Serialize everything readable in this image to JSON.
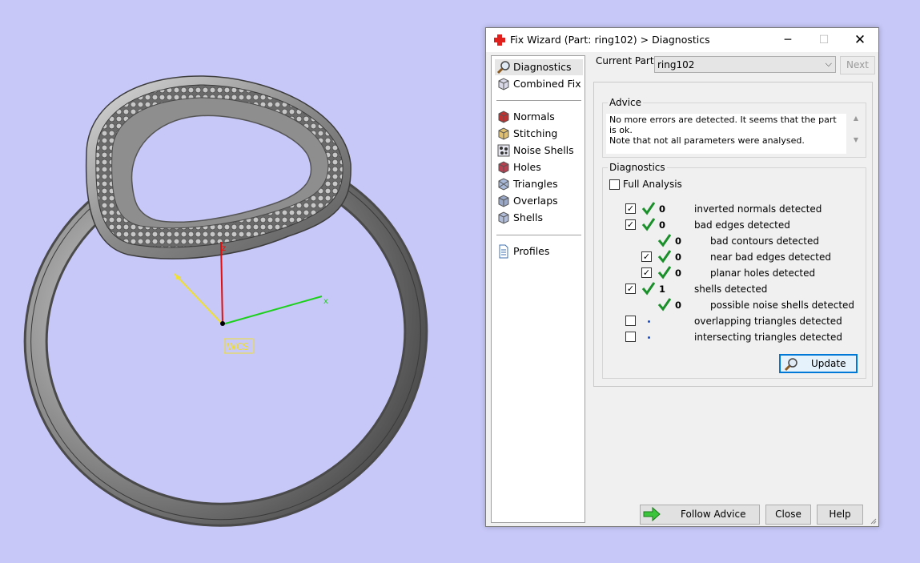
{
  "viewport": {
    "background": "#c8c8f8",
    "axes": {
      "z_label": "z",
      "x_label": "x",
      "y_label": "y",
      "wcs_label": "WCS"
    }
  },
  "dialog": {
    "title": "Fix Wizard (Part: ring102) > Diagnostics",
    "min_glyph": "─",
    "max_glyph": "☐",
    "close_glyph": "✕"
  },
  "nav": {
    "top_items": [
      {
        "label": "Diagnostics",
        "icon": "magnifier-icon",
        "selected": true
      },
      {
        "label": "Combined Fix",
        "icon": "cube-icon"
      }
    ],
    "fix_items": [
      {
        "label": "Normals",
        "icon": "normals-cube-icon"
      },
      {
        "label": "Stitching",
        "icon": "stitching-cube-icon"
      },
      {
        "label": "Noise Shells",
        "icon": "noise-shells-icon"
      },
      {
        "label": "Holes",
        "icon": "holes-cube-icon"
      },
      {
        "label": "Triangles",
        "icon": "triangles-cube-icon"
      },
      {
        "label": "Overlaps",
        "icon": "overlaps-cube-icon"
      },
      {
        "label": "Shells",
        "icon": "shells-cube-icon"
      }
    ],
    "bottom_items": [
      {
        "label": "Profiles",
        "icon": "document-icon"
      }
    ]
  },
  "current_part": {
    "label": "Current Part:",
    "value": "ring102",
    "next_label": "Next"
  },
  "advice": {
    "title": "Advice",
    "line1": "No more errors are detected. It seems that the part is ok.",
    "line2": "Note that not all parameters were analysed."
  },
  "diagnostics": {
    "title": "Diagnostics",
    "full_analysis_label": "Full Analysis",
    "full_analysis_checked": false,
    "rows": [
      {
        "has_checkbox": true,
        "checked": true,
        "status": "ok",
        "count": "0",
        "label": "inverted normals detected",
        "indent": 0
      },
      {
        "has_checkbox": true,
        "checked": true,
        "status": "ok",
        "count": "0",
        "label": "bad edges detected",
        "indent": 0
      },
      {
        "has_checkbox": false,
        "checked": false,
        "status": "ok",
        "count": "0",
        "label": "bad contours detected",
        "indent": 1
      },
      {
        "has_checkbox": true,
        "checked": true,
        "status": "ok",
        "count": "0",
        "label": "near bad edges detected",
        "indent": 1
      },
      {
        "has_checkbox": true,
        "checked": true,
        "status": "ok",
        "count": "0",
        "label": "planar holes detected",
        "indent": 1
      },
      {
        "has_checkbox": true,
        "checked": true,
        "status": "ok",
        "count": "1",
        "label": "shells detected",
        "indent": 0
      },
      {
        "has_checkbox": false,
        "checked": false,
        "status": "ok",
        "count": "0",
        "label": "possible noise shells detected",
        "indent": 1
      },
      {
        "has_checkbox": true,
        "checked": false,
        "status": "none",
        "count": "",
        "label": "overlapping triangles detected",
        "indent": 0
      },
      {
        "has_checkbox": true,
        "checked": false,
        "status": "none",
        "count": "",
        "label": "intersecting triangles detected",
        "indent": 0
      }
    ],
    "update_label": "Update"
  },
  "buttons": {
    "follow_advice": "Follow Advice",
    "close": "Close",
    "help": "Help"
  },
  "colors": {
    "accent": "#0078d7",
    "check_green": "#1a8f2a",
    "title_icon_red": "#e0201c"
  }
}
